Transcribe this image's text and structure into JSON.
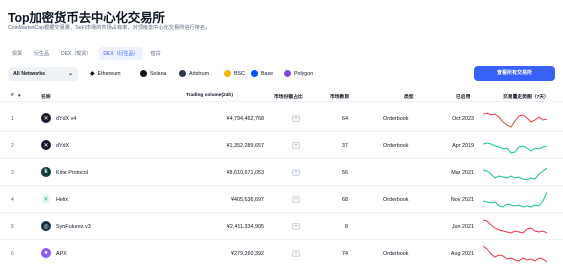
{
  "header": {
    "title": "Top加密货币去中心化交易所",
    "subtitle": "CoinMarketCap根据交易量、SeFi市场的市场占有率，对顶级去中心化交易所进行排名。"
  },
  "tabs": [
    {
      "label": "现货",
      "active": false
    },
    {
      "label": "衍生品",
      "active": false
    },
    {
      "label": "DEX（现货）",
      "active": false
    },
    {
      "label": "DEX（衍生品）",
      "active": true
    },
    {
      "label": "借贷",
      "active": false
    }
  ],
  "filters": {
    "network_select": "All Networks",
    "chains": [
      {
        "label": "Ethereum",
        "icon": "ethereum-icon",
        "color": "#627eea"
      },
      {
        "label": "Solana",
        "icon": "solana-icon",
        "color": "#14f195"
      },
      {
        "label": "Arbitrum",
        "icon": "arbitrum-icon",
        "color": "#2d374b"
      },
      {
        "label": "BSC",
        "icon": "bsc-icon",
        "color": "#f0b90b"
      },
      {
        "label": "Base",
        "icon": "base-icon",
        "color": "#0052ff"
      },
      {
        "label": "Polygon",
        "icon": "polygon-icon",
        "color": "#8247e5"
      }
    ],
    "cta_label": "查看所有交易所"
  },
  "table": {
    "columns": [
      "#",
      "名称",
      "Trading volume(24h)",
      "市场份额占比",
      "市场数目",
      "类型",
      "已启用",
      "交易量走势图（7天）"
    ],
    "rows": [
      {
        "rank": "1",
        "name": "dYdX v4",
        "volume": "¥4,794,462,768",
        "share": "--",
        "markets": "64",
        "type": "Orderbook",
        "launched": "Oct 2023",
        "trend": "down",
        "logo": "dydx-logo-icon",
        "logo_color": "#1a1a2e"
      },
      {
        "rank": "2",
        "name": "dYdX",
        "volume": "¥1,352,289,657",
        "share": "--",
        "markets": "37",
        "type": "Orderbook",
        "launched": "Apr 2019",
        "trend": "up",
        "logo": "dydx-logo-icon",
        "logo_color": "#1a1a2e"
      },
      {
        "rank": "3",
        "name": "Kine Protocol",
        "volume": "¥8,610,671,053",
        "share": "--",
        "markets": "56",
        "type": "",
        "launched": "Mar 2021",
        "trend": "up",
        "logo": "kine-logo-icon",
        "logo_color": "#0f3c3c"
      },
      {
        "rank": "4",
        "name": "Helix",
        "volume": "¥405,636,697",
        "share": "--",
        "markets": "68",
        "type": "Orderbook",
        "launched": "Nov 2021",
        "trend": "up",
        "logo": "helix-logo-icon",
        "logo_color": "#e8f6f5"
      },
      {
        "rank": "5",
        "name": "SynFutures v3",
        "volume": "¥2,411,334,905",
        "share": "--",
        "markets": "8",
        "type": "",
        "launched": "Jun 2021",
        "trend": "down",
        "logo": "synfutures-logo-icon",
        "logo_color": "#0e2a47"
      },
      {
        "rank": "6",
        "name": "APX",
        "volume": "¥279,260,392",
        "share": "--",
        "markets": "74",
        "type": "Orderbook",
        "launched": "Aug 2021",
        "trend": "down",
        "logo": "apx-logo-icon",
        "logo_color": "#8b5cf6"
      }
    ]
  },
  "colors": {
    "accent": "#3861fb",
    "up": "#16c784",
    "down": "#ea3943"
  }
}
